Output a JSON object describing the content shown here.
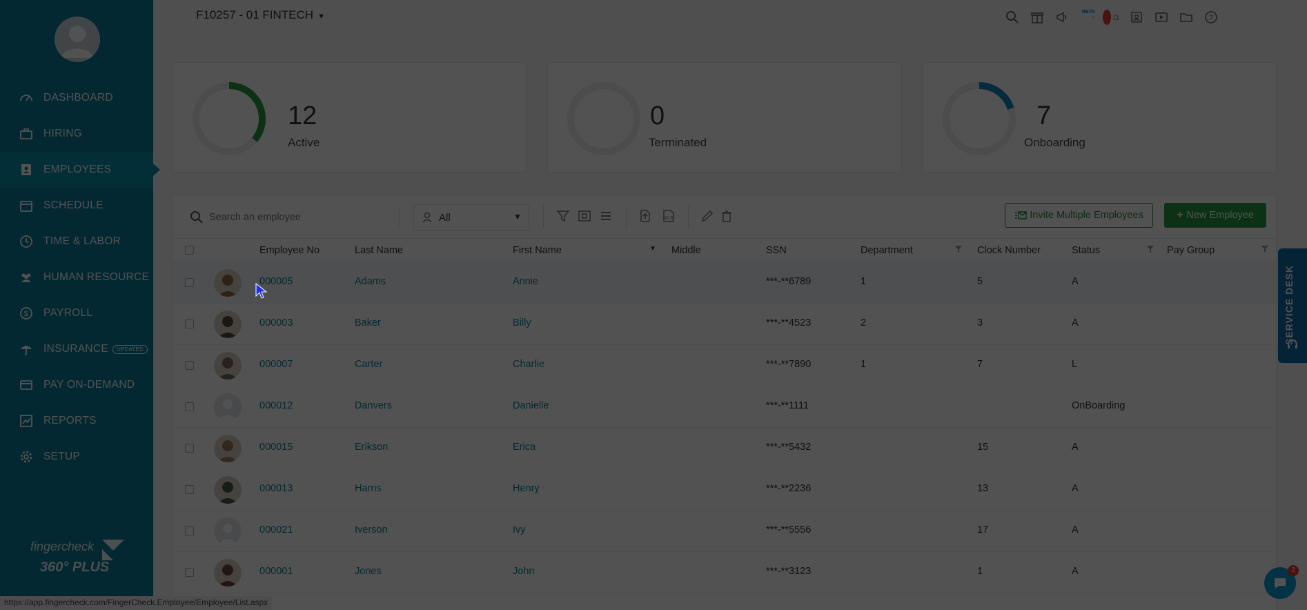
{
  "sidebar": {
    "items": [
      {
        "label": "DASHBOARD",
        "icon": "dashboard-icon"
      },
      {
        "label": "HIRING",
        "icon": "briefcase-icon"
      },
      {
        "label": "EMPLOYEES",
        "icon": "employee-badge-icon",
        "active": true
      },
      {
        "label": "SCHEDULE",
        "icon": "calendar-icon"
      },
      {
        "label": "TIME & LABOR",
        "icon": "clock-icon"
      },
      {
        "label": "HUMAN RESOURCE",
        "icon": "people-icon"
      },
      {
        "label": "PAYROLL",
        "icon": "dollar-icon"
      },
      {
        "label": "INSURANCE",
        "icon": "umbrella-icon",
        "badge": "UPDATED"
      },
      {
        "label": "PAY ON-DEMAND",
        "icon": "card-icon"
      },
      {
        "label": "REPORTS",
        "icon": "chart-icon"
      },
      {
        "label": "SETUP",
        "icon": "gear-icon"
      }
    ],
    "brand_line1": "fingercheck",
    "brand_line2": "360° PLUS"
  },
  "header": {
    "company": "F10257 - 01 FINTECH",
    "beta_label": "BETA",
    "icons": [
      "search-icon",
      "gift-icon",
      "megaphone-icon",
      "feedback-icon",
      "bell-icon",
      "contact-card-icon",
      "video-icon",
      "folder-icon",
      "help-icon"
    ]
  },
  "stats": [
    {
      "value": "12",
      "label": "Active",
      "color": "#2b9a3e",
      "fraction": 0.36
    },
    {
      "value": "0",
      "label": "Terminated",
      "color": "#999999",
      "fraction": 0
    },
    {
      "value": "7",
      "label": "Onboarding",
      "color": "#1186c0",
      "fraction": 0.2
    }
  ],
  "toolbar": {
    "search_placeholder": "Search an employee",
    "filter_value": "All",
    "invite_label": "Invite Multiple Employees",
    "new_label": "New Employee"
  },
  "columns": [
    "Employee No",
    "Last Name",
    "First Name",
    "Middle",
    "SSN",
    "Department",
    "Clock Number",
    "Status",
    "Pay Group"
  ],
  "rows": [
    {
      "no": "000005",
      "last": "Adams",
      "first": "Annie",
      "middle": "",
      "ssn": "***-**6789",
      "dept": "1",
      "clock": "5",
      "status": "A",
      "photo": "photo"
    },
    {
      "no": "000003",
      "last": "Baker",
      "first": "Billy",
      "middle": "",
      "ssn": "***-**4523",
      "dept": "2",
      "clock": "3",
      "status": "A",
      "photo": "photo"
    },
    {
      "no": "000007",
      "last": "Carter",
      "first": "Charlie",
      "middle": "",
      "ssn": "***-**7890",
      "dept": "1",
      "clock": "7",
      "status": "L",
      "photo": "photo"
    },
    {
      "no": "000012",
      "last": "Danvers",
      "first": "Danielle",
      "middle": "",
      "ssn": "***-**1111",
      "dept": "",
      "clock": "",
      "status": "OnBoarding",
      "photo": "placeholder"
    },
    {
      "no": "000015",
      "last": "Erikson",
      "first": "Erica",
      "middle": "",
      "ssn": "***-**5432",
      "dept": "",
      "clock": "15",
      "status": "A",
      "photo": "photo"
    },
    {
      "no": "000013",
      "last": "Harris",
      "first": "Henry",
      "middle": "",
      "ssn": "***-**2236",
      "dept": "",
      "clock": "13",
      "status": "A",
      "photo": "photo"
    },
    {
      "no": "000021",
      "last": "Iverson",
      "first": "Ivy",
      "middle": "",
      "ssn": "***-**5556",
      "dept": "",
      "clock": "17",
      "status": "A",
      "photo": "placeholder"
    },
    {
      "no": "000001",
      "last": "Jones",
      "first": "John",
      "middle": "",
      "ssn": "***-**3123",
      "dept": "",
      "clock": "1",
      "status": "A",
      "photo": "photo"
    }
  ],
  "service_desk": "SERVICE DESK",
  "chat_count": "2",
  "status_url": "https://app.fingercheck.com/FingerCheck.Employee/Employee/List.aspx"
}
